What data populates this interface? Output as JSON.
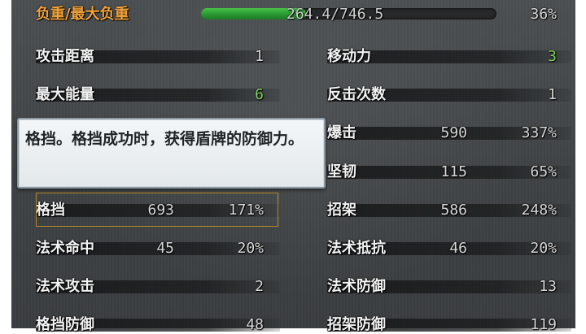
{
  "header": {
    "weight_label": "负重/最大负重",
    "weight_value": "264.4/746.5",
    "weight_percent": "36%",
    "weight_fraction": 0.354
  },
  "stats": {
    "attack_range": {
      "label": "攻击距离",
      "value": "1"
    },
    "movement": {
      "label": "移动力",
      "value": "3"
    },
    "max_energy": {
      "label": "最大能量",
      "value": "6"
    },
    "counter_count": {
      "label": "反击次数",
      "value": "1"
    },
    "crit": {
      "label": "爆击",
      "value": "590",
      "percent": "337%"
    },
    "toughness": {
      "label": "坚韧",
      "value": "115",
      "percent": "65%"
    },
    "block": {
      "label": "格挡",
      "value": "693",
      "percent": "171%"
    },
    "parry": {
      "label": "招架",
      "value": "586",
      "percent": "248%"
    },
    "spell_hit": {
      "label": "法术命中",
      "value": "45",
      "percent": "20%"
    },
    "spell_resist": {
      "label": "法术抵抗",
      "value": "46",
      "percent": "20%"
    },
    "spell_attack": {
      "label": "法术攻击",
      "value": "2"
    },
    "spell_defense": {
      "label": "法术防御",
      "value": "13"
    },
    "block_defense": {
      "label": "格挡防御",
      "value": "48"
    },
    "parry_defense": {
      "label": "招架防御",
      "value": "119"
    }
  },
  "tooltip": {
    "text": "格挡。格挡成功时，获得盾牌的防御力。"
  },
  "colors": {
    "title": "#f2a23a",
    "weight_bar": "#2c9b34",
    "green_value": "#7fd15e",
    "highlight_border": "#b48a2a"
  }
}
